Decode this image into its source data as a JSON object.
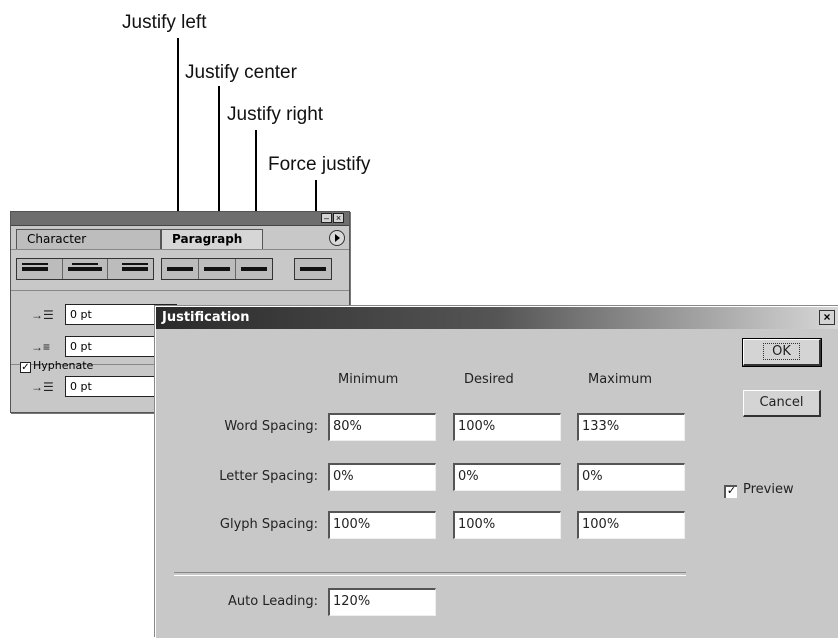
{
  "callouts": {
    "justify_left": "Justify left",
    "justify_center": "Justify center",
    "justify_right": "Justify right",
    "force_justify": "Force justify"
  },
  "palette": {
    "tabs": [
      "Character",
      "Paragraph"
    ],
    "active_tab": "Paragraph",
    "indent_fields": [
      "0 pt",
      "0 pt",
      "0 pt"
    ],
    "hyphenate_label": "Hyphenate",
    "hyphenate_checked": "✓"
  },
  "dialog": {
    "title": "Justification",
    "close_glyph": "×",
    "columns": [
      "Minimum",
      "Desired",
      "Maximum"
    ],
    "rows": [
      {
        "label": "Word Spacing:",
        "values": [
          "80%",
          "100%",
          "133%"
        ]
      },
      {
        "label": "Letter Spacing:",
        "values": [
          "0%",
          "0%",
          "0%"
        ]
      },
      {
        "label": "Glyph Spacing:",
        "values": [
          "100%",
          "100%",
          "100%"
        ]
      }
    ],
    "auto_leading_label": "Auto Leading:",
    "auto_leading_value": "120%",
    "ok_label": "OK",
    "cancel_label": "Cancel",
    "preview_label": "Preview",
    "preview_checked": "✓"
  }
}
